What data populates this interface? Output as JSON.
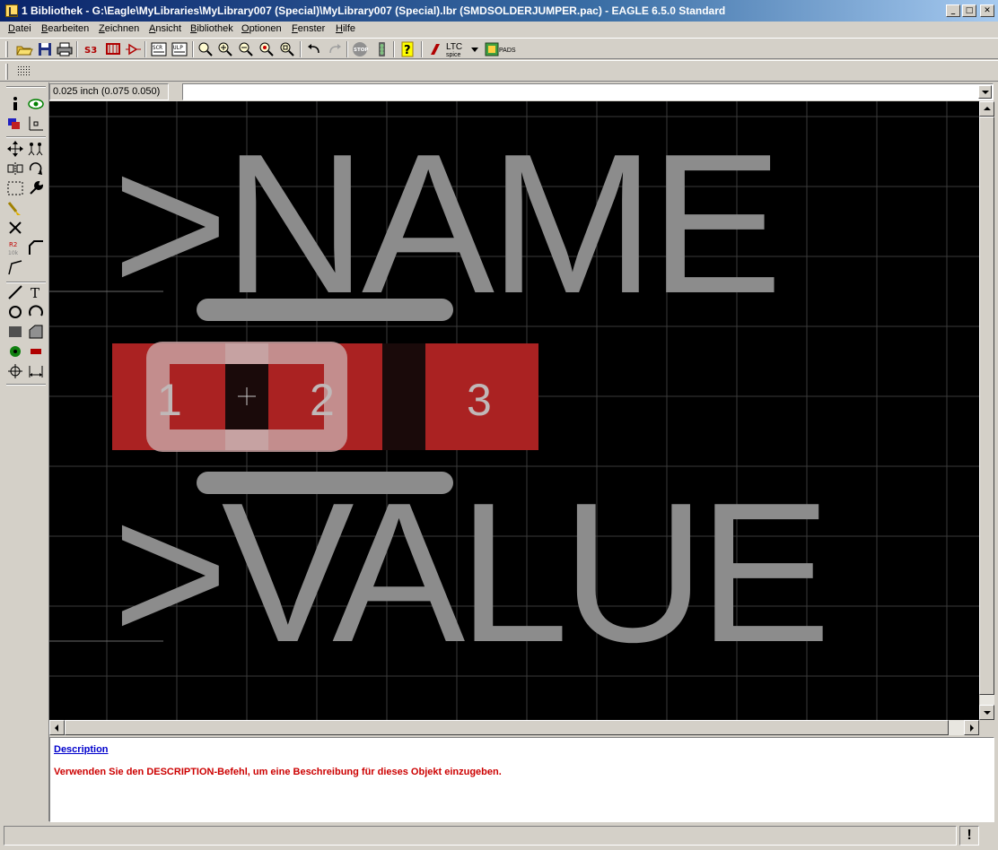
{
  "window": {
    "title": "1 Bibliothek - G:\\Eagle\\MyLibraries\\MyLibrary007 (Special)\\MyLibrary007 (Special).lbr (SMDSOLDERJUMPER.pac) - EAGLE 6.5.0 Standard",
    "minimize": "_",
    "maximize": "□",
    "close": "✕"
  },
  "menu": [
    "Datei",
    "Bearbeiten",
    "Zeichnen",
    "Ansicht",
    "Bibliothek",
    "Optionen",
    "Fenster",
    "Hilfe"
  ],
  "toolbar": {
    "ltc_label": "LTC",
    "ltc_sub": "spice",
    "pads_label": "PADS",
    "stop_label": "STOP"
  },
  "coords": "0.025 inch (0.075 0.050)",
  "command_line": "",
  "canvas": {
    "name_text": ">NAME",
    "value_text": ">VALUE",
    "pad_labels": [
      "1",
      "2",
      "3"
    ],
    "colors": {
      "background": "#000000",
      "grid": "#3a3a3a",
      "pad": "#aa2222",
      "text": "#8c8c8c",
      "tstop": "#c8a0a0"
    }
  },
  "description": {
    "link": "Description",
    "text": "Verwenden Sie den DESCRIPTION-Befehl, um eine Beschreibung für dieses Objekt einzugeben."
  },
  "status": {
    "text": "",
    "warn": "!"
  }
}
